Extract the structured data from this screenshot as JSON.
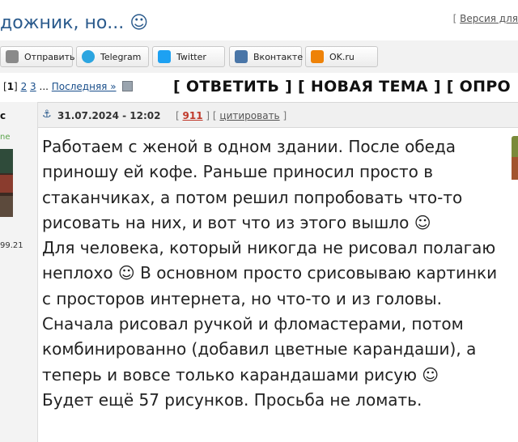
{
  "topbar": {
    "title": "дожник, но... ☺",
    "version_prefix": "[ ",
    "version_link": "Версия для",
    "version_suffix": ""
  },
  "share": {
    "buttons": [
      {
        "label": "Отправить",
        "icon": "mail-icon",
        "color": "#8a8a8a"
      },
      {
        "label": "Telegram",
        "icon": "telegram-icon",
        "color": "#2ca5e0"
      },
      {
        "label": "Twitter",
        "icon": "twitter-icon",
        "color": "#1da1f2"
      },
      {
        "label": "Вконтакте",
        "icon": "vk-icon",
        "color": "#4a76a8"
      },
      {
        "label": "OK.ru",
        "icon": "ok-icon",
        "color": "#ee8208"
      }
    ]
  },
  "pager": {
    "current": "1",
    "page2": "2",
    "page3": "3",
    "ellipsis": "...",
    "last": "Последняя »"
  },
  "actions": {
    "reply": "[ ОТВЕТИТЬ ]",
    "new_topic": "[ НОВАЯ ТЕМА ]",
    "poll": "[ ОПРО"
  },
  "author": {
    "name": "с",
    "status": "ne",
    "reg_date": "99.21"
  },
  "post": {
    "anchor": "⚓",
    "date": "31.07.2024 - 12:02",
    "bracket_open": "[",
    "number": "911",
    "separator": "] [",
    "quote": "цитировать",
    "bracket_close": "]",
    "lines": [
      "Работаем с женой в одном здании. После обеда",
      "приношу ей кофе. Раньше приносил просто в",
      "стаканчиках, а потом решил попробовать что-то",
      "рисовать на них, и вот что из этого вышло ☺",
      "Для человека, который никогда не рисовал полагаю",
      "неплохо ☺ В основном просто срисовываю картинки",
      "с просторов интернета, но что-то и из головы.",
      "Сначала рисовал ручкой и фломастерами, потом",
      "комбинированно (добавил цветные карандаши), а",
      "теперь и вовсе только карандашами рисую ☺",
      "Будет ещё 57 рисунков. Просьба не ломать."
    ]
  },
  "colors": {
    "link": "#1a4f8b",
    "post_number": "#c0392b",
    "status": "#5aa34a"
  }
}
